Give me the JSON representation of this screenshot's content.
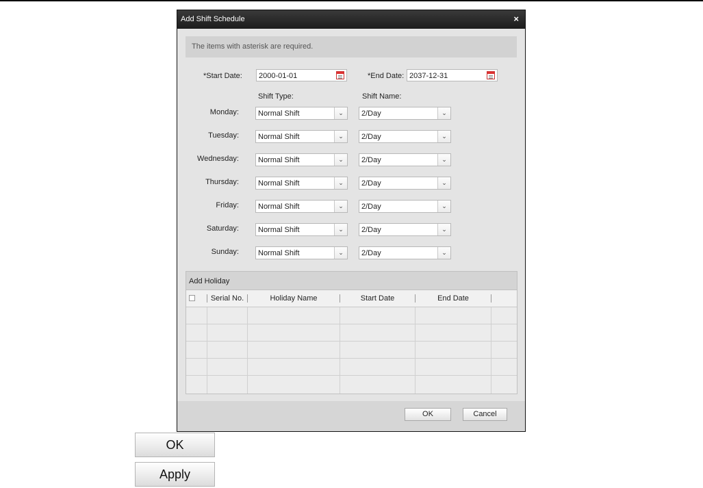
{
  "dialog": {
    "title": "Add Shift Schedule",
    "close_glyph": "×",
    "notice": "The items with asterisk are required.",
    "start_date_label": "*Start Date:",
    "start_date_value": "2000-01-01",
    "end_date_label": "*End Date:",
    "end_date_value": "2037-12-31",
    "shift_type_header": "Shift Type:",
    "shift_name_header": "Shift Name:",
    "days": [
      {
        "label": "Monday:",
        "shift_type": "Normal Shift",
        "shift_name": "2/Day"
      },
      {
        "label": "Tuesday:",
        "shift_type": "Normal Shift",
        "shift_name": "2/Day"
      },
      {
        "label": "Wednesday:",
        "shift_type": "Normal Shift",
        "shift_name": "2/Day"
      },
      {
        "label": "Thursday:",
        "shift_type": "Normal Shift",
        "shift_name": "2/Day"
      },
      {
        "label": "Friday:",
        "shift_type": "Normal Shift",
        "shift_name": "2/Day"
      },
      {
        "label": "Saturday:",
        "shift_type": "Normal Shift",
        "shift_name": "2/Day"
      },
      {
        "label": "Sunday:",
        "shift_type": "Normal Shift",
        "shift_name": "2/Day"
      }
    ],
    "holiday": {
      "title": "Add Holiday",
      "columns": [
        "Serial No.",
        "Holiday Name",
        "Start Date",
        "End Date"
      ]
    },
    "ok_label": "OK",
    "cancel_label": "Cancel"
  },
  "extra_buttons": {
    "ok_label": "OK",
    "apply_label": "Apply"
  },
  "icons": {
    "close": "close-icon",
    "calendar": "calendar-icon",
    "dropdown": "chevron-down-icon"
  }
}
